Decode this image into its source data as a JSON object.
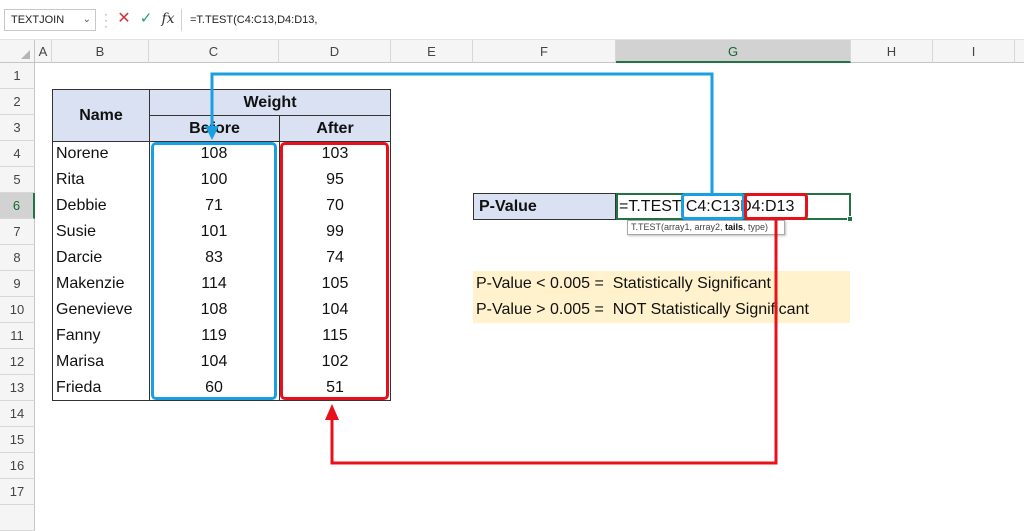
{
  "formula_bar": {
    "name_box": "TEXTJOIN",
    "formula": "=T.TEST(C4:C13,D4:D13,",
    "cancel_icon": "close-icon",
    "enter_icon": "checkmark-icon",
    "fx_label": "fx"
  },
  "columns": [
    "A",
    "B",
    "C",
    "D",
    "E",
    "F",
    "G",
    "H",
    "I"
  ],
  "selected_column": "G",
  "rows": [
    "1",
    "2",
    "3",
    "4",
    "5",
    "6",
    "7",
    "8",
    "9",
    "10",
    "11",
    "12",
    "13",
    "14",
    "15",
    "16",
    "17"
  ],
  "selected_row": "6",
  "table": {
    "name_header": "Name",
    "weight_header": "Weight",
    "before_header": "Before",
    "after_header": "After",
    "records": [
      {
        "name": "Norene",
        "before": "108",
        "after": "103"
      },
      {
        "name": "Rita",
        "before": "100",
        "after": "95"
      },
      {
        "name": "Debbie",
        "before": "71",
        "after": "70"
      },
      {
        "name": "Susie",
        "before": "101",
        "after": "99"
      },
      {
        "name": "Darcie",
        "before": "83",
        "after": "74"
      },
      {
        "name": "Makenzie",
        "before": "114",
        "after": "105"
      },
      {
        "name": "Genevieve",
        "before": "108",
        "after": "104"
      },
      {
        "name": "Fanny",
        "before": "119",
        "after": "115"
      },
      {
        "name": "Marisa",
        "before": "104",
        "after": "102"
      },
      {
        "name": "Frieda",
        "before": "60",
        "after": "51"
      }
    ]
  },
  "pvalue": {
    "label": "P-Value",
    "formula_prefix": "=T.TEST ",
    "ref_before": "C4:C13",
    "ref_after": "D4:D13",
    "tooltip_prefix": "T.TEST(array1, array2, ",
    "tooltip_bold": "tails",
    "tooltip_suffix": ", type)"
  },
  "notes": [
    "P-Value < 0.005 =  Statistically Significant",
    "P-Value > 0.005 =  NOT Statistically Significant"
  ],
  "colors": {
    "accent_green": "#217346",
    "table_header_fill": "#d9e1f2",
    "note_fill": "#fff2cc",
    "highlight_blue": "#1aa0e0",
    "highlight_red": "#e8101a"
  }
}
